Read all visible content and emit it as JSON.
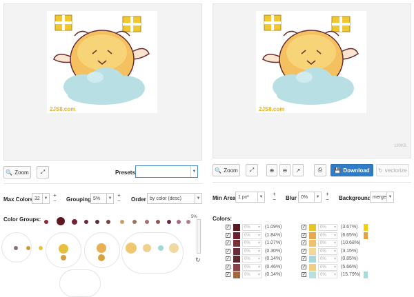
{
  "left": {
    "zoom_label": "Zoom",
    "presets_label": "Presets",
    "presets_value": "",
    "max_colors_label": "Max Colors",
    "max_colors_value": "32",
    "grouping_label": "Grouping",
    "grouping_value": "5%",
    "order_label": "Order",
    "order_value": "by color (desc)",
    "color_groups_label": "Color Groups:",
    "slider_value": "5%"
  },
  "right": {
    "file_size": "130KB",
    "zoom_label": "Zoom",
    "download_label": "Download",
    "vectorize_label": "vectorize",
    "min_area_label": "Min Area",
    "min_area_value": "1 px²",
    "blur_label": "Blur",
    "blur_value": "0%",
    "background_label": "Background",
    "background_value": "merge",
    "colors_label": "Colors:"
  },
  "watermark": "2JS8.com",
  "group_dots_row1": [
    "#8a2a32",
    "#5b1820",
    "#7a2030",
    "#6a2a38",
    "#5a3040",
    "#7a4048",
    "#caa060",
    "#9a7060",
    "#a07070",
    "#8a5a50",
    "#6a2a3a",
    "#a86a78",
    "#b08090"
  ],
  "group_dots_row2": [
    "#8a7080",
    "#c89a3a",
    "#e8c040",
    "#e8c040",
    "#d4a040",
    "#e8b050",
    "#f0c870",
    "#e8c870",
    "#f0d090",
    "#a0d8d8",
    "#f0d8a0"
  ],
  "colors_left": [
    {
      "swatch": "#5a1a22",
      "pct": "0%",
      "value": "(1.09%)"
    },
    {
      "swatch": "#6a2030",
      "pct": "0%",
      "value": "(1.84%)"
    },
    {
      "swatch": "#7a3038",
      "pct": "0%",
      "value": "(1.07%)"
    },
    {
      "swatch": "#6a2a3a",
      "pct": "0%",
      "value": "(0.30%)"
    },
    {
      "swatch": "#5a2a30",
      "pct": "0%",
      "value": "(0.14%)"
    },
    {
      "swatch": "#8a4048",
      "pct": "0%",
      "value": "(0.46%)"
    },
    {
      "swatch": "#a06a40",
      "pct": "0%",
      "value": "(0.14%)"
    }
  ],
  "colors_right": [
    {
      "swatch": "#e8c428",
      "pct": "0%",
      "value": "(3.67%)",
      "bar": "#f0d000"
    },
    {
      "swatch": "#e8a850",
      "pct": "0%",
      "value": "(6.65%)",
      "bar": "#e8a040"
    },
    {
      "swatch": "#f0c070",
      "pct": "0%",
      "value": "(10.68%)",
      "bar": ""
    },
    {
      "swatch": "#f4d898",
      "pct": "0%",
      "value": "(3.15%)",
      "bar": ""
    },
    {
      "swatch": "#a8d8dc",
      "pct": "0%",
      "value": "(0.85%)",
      "bar": ""
    },
    {
      "swatch": "#f0d080",
      "pct": "0%",
      "value": "(5.66%)",
      "bar": ""
    },
    {
      "swatch": "#b8e0e0",
      "pct": "0%",
      "value": "(15.79%)",
      "bar": "#a8dcdc"
    }
  ],
  "icons": {
    "zoom": "magnifier-icon",
    "fit": "expand-arrows-icon",
    "zoom_in": "zoom-in-icon",
    "zoom_out": "zoom-out-icon",
    "fullscreen": "diagonal-arrows-icon",
    "print": "printer-icon",
    "download": "save-icon",
    "vectorize": "refresh-icon",
    "reset": "refresh-icon"
  }
}
